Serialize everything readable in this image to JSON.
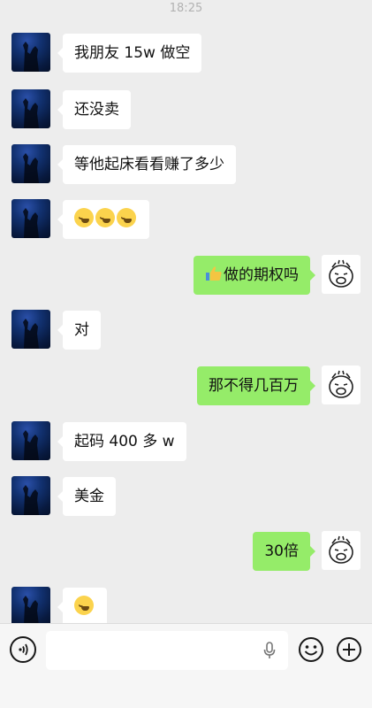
{
  "status": {
    "time": "18:25"
  },
  "messages": [
    {
      "side": "in",
      "text": "我朋友 15w 做空"
    },
    {
      "side": "in",
      "text": "还没卖"
    },
    {
      "side": "in",
      "text": "等他起床看看赚了多少"
    },
    {
      "side": "in",
      "emoji": [
        "laugh-cry-emoji",
        "laugh-cry-emoji",
        "laugh-cry-emoji"
      ]
    },
    {
      "side": "out",
      "text": "做的期权吗",
      "prefix_icon": "thumbs-up-emoji"
    },
    {
      "side": "in",
      "text": "对"
    },
    {
      "side": "out",
      "text": "那不得几百万"
    },
    {
      "side": "in",
      "text": "起码 400 多 w"
    },
    {
      "side": "in",
      "text": "美金"
    },
    {
      "side": "out",
      "text": "30倍"
    },
    {
      "side": "in",
      "emoji": [
        "laugh-cry-emoji"
      ]
    }
  ],
  "input": {
    "placeholder": ""
  },
  "colors": {
    "background": "#ededed",
    "bubble_in": "#ffffff",
    "bubble_out": "#95ec69"
  }
}
